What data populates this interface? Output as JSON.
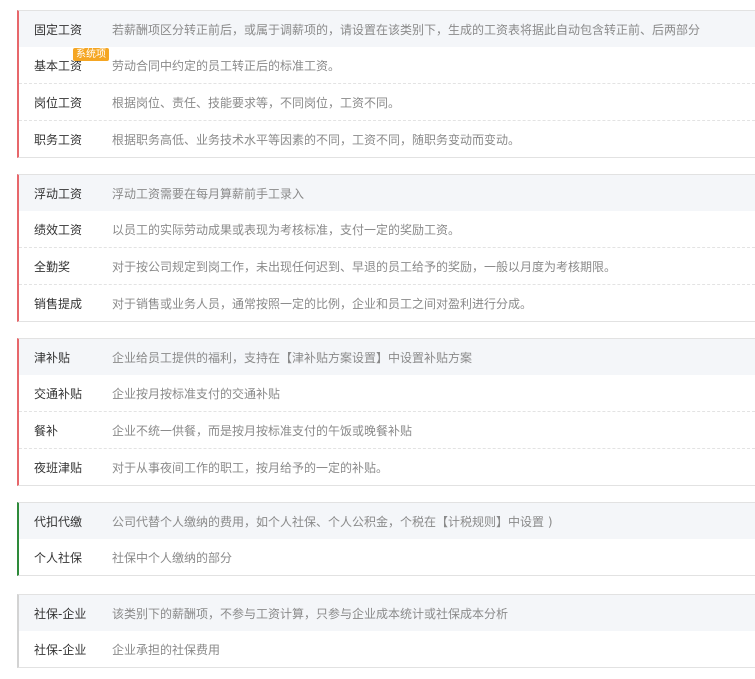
{
  "groups": [
    {
      "items": [
        {
          "name": "固定工资",
          "desc": "若薪酬项区分转正前后，或属于调薪项的，请设置在该类别下，生成的工资表将据此自动包含转正前、后两部分"
        },
        {
          "name": "基本工资",
          "badge": "系统项",
          "desc": "劳动合同中约定的员工转正后的标准工资。"
        },
        {
          "name": "岗位工资",
          "desc": "根据岗位、责任、技能要求等，不同岗位，工资不同。"
        },
        {
          "name": "职务工资",
          "desc": "根据职务高低、业务技术水平等因素的不同，工资不同，随职务变动而变动。"
        }
      ]
    },
    {
      "items": [
        {
          "name": "浮动工资",
          "desc": "浮动工资需要在每月算薪前手工录入"
        },
        {
          "name": "绩效工资",
          "desc": "以员工的实际劳动成果或表现为考核标准，支付一定的奖励工资。"
        },
        {
          "name": "全勤奖",
          "desc": "对于按公司规定到岗工作，未出现任何迟到、早退的员工给予的奖励，一般以月度为考核期限。"
        },
        {
          "name": "销售提成",
          "desc": "对于销售或业务人员，通常按照一定的比例，企业和员工之间对盈利进行分成。"
        }
      ]
    },
    {
      "items": [
        {
          "name": "津补贴",
          "desc": "企业给员工提供的福利，支持在【津补贴方案设置】中设置补贴方案"
        },
        {
          "name": "交通补贴",
          "desc": "企业按月按标准支付的交通补贴"
        },
        {
          "name": "餐补",
          "desc": "企业不统一供餐，而是按月按标准支付的午饭或晚餐补贴"
        },
        {
          "name": "夜班津贴",
          "desc": "对于从事夜间工作的职工，按月给予的一定的补贴。"
        }
      ]
    },
    {
      "items": [
        {
          "name": "代扣代缴",
          "desc": "公司代替个人缴纳的费用，如个人社保、个人公积金，个税在【计税规则】中设置 )"
        },
        {
          "name": "个人社保",
          "desc": "社保中个人缴纳的部分"
        }
      ]
    },
    {
      "items": [
        {
          "name": "社保-企业",
          "desc": "该类别下的薪酬项，不参与工资计算，只参与企业成本统计或社保成本分析"
        },
        {
          "name": "社保-企业",
          "desc": "企业承担的社保费用"
        }
      ]
    }
  ]
}
